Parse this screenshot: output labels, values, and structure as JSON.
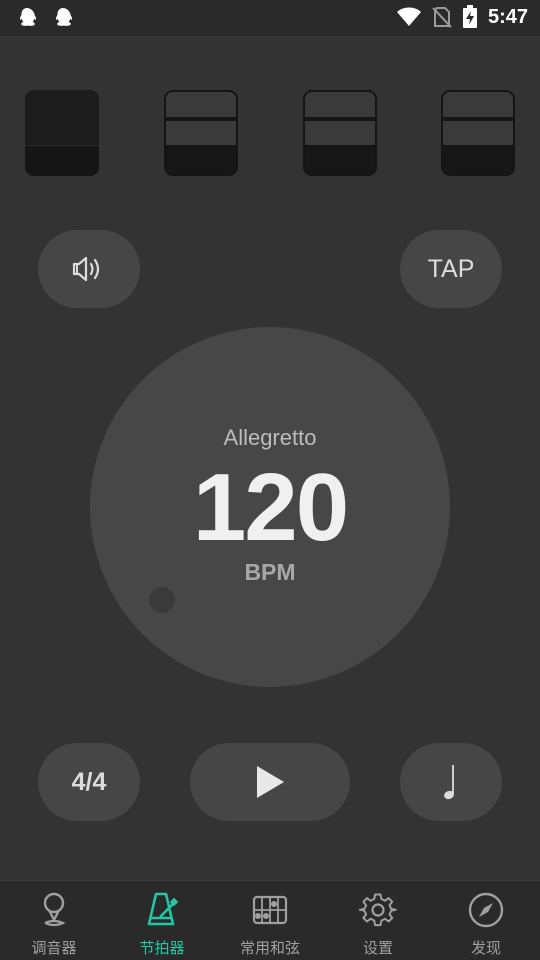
{
  "status_bar": {
    "time": "5:47",
    "left_icons": [
      "qq-icon",
      "qq-icon"
    ],
    "right_icons": [
      "wifi-icon",
      "no-sim-icon",
      "battery-charging-icon"
    ]
  },
  "beats": [
    {
      "type": "accent"
    },
    {
      "type": "normal"
    },
    {
      "type": "normal"
    },
    {
      "type": "normal"
    }
  ],
  "controls": {
    "sound_icon": "speaker-icon",
    "tap_label": "TAP",
    "time_signature": "4/4",
    "play_icon": "play-icon",
    "note_symbol": "♩"
  },
  "tempo": {
    "name": "Allegretto",
    "bpm": "120",
    "unit": "BPM"
  },
  "tabs": [
    {
      "label": "调音器",
      "icon": "tuner-pin-icon",
      "active": false
    },
    {
      "label": "节拍器",
      "icon": "metronome-icon",
      "active": true
    },
    {
      "label": "常用和弦",
      "icon": "chord-chart-icon",
      "active": false
    },
    {
      "label": "设置",
      "icon": "gear-icon",
      "active": false
    },
    {
      "label": "发现",
      "icon": "compass-icon",
      "active": false
    }
  ],
  "colors": {
    "background": "#333333",
    "accent": "#22c7a5",
    "button": "#464646"
  }
}
